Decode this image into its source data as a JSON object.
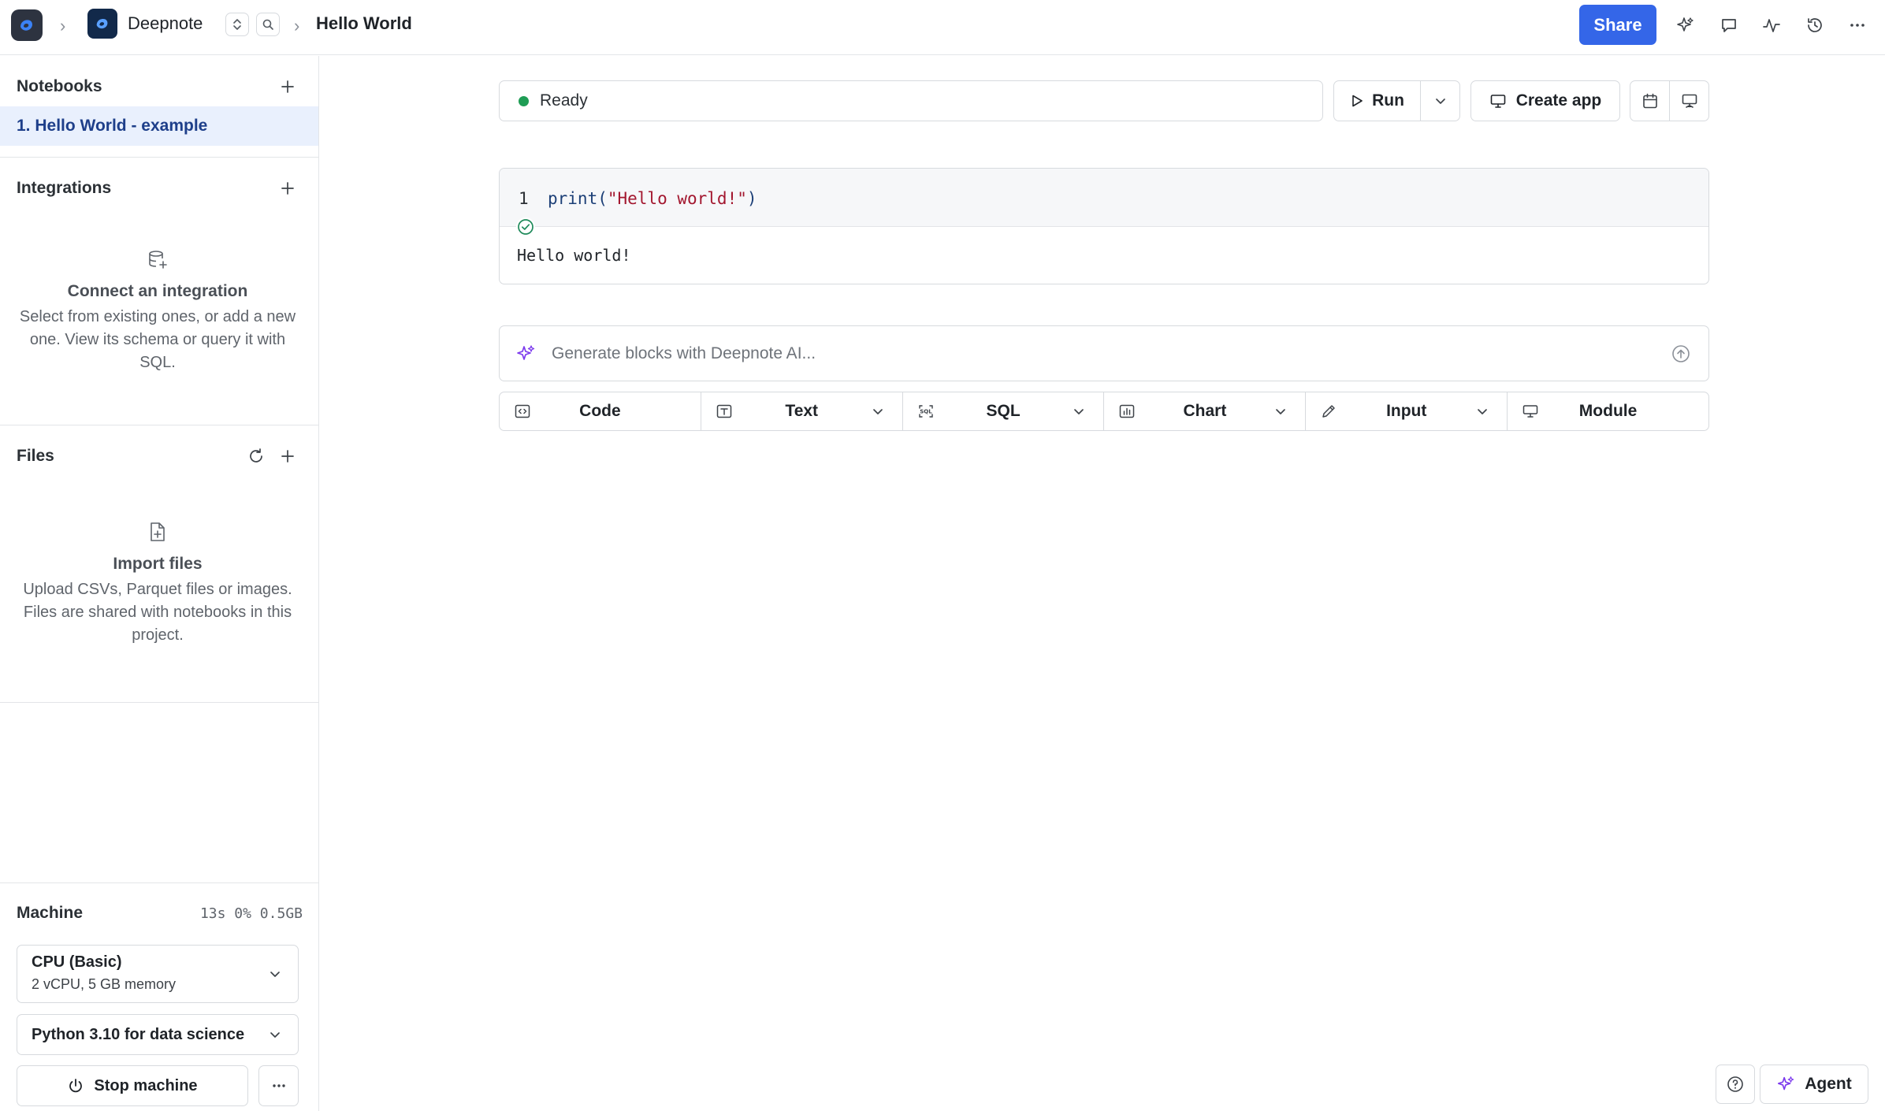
{
  "topbar": {
    "workspace_name": "Deepnote",
    "page_name": "Hello World",
    "share_label": "Share"
  },
  "sidebar": {
    "notebooks_title": "Notebooks",
    "notebook_items": [
      {
        "label": "1. Hello World - example",
        "active": true
      }
    ],
    "integrations_title": "Integrations",
    "integrations_empty": {
      "title": "Connect an integration",
      "description": "Select from existing ones, or add a new one. View its schema or query it with SQL."
    },
    "files_title": "Files",
    "files_empty": {
      "title": "Import files",
      "description": "Upload CSVs, Parquet files or images. Files are shared with notebooks in this project."
    },
    "machine": {
      "title": "Machine",
      "stats": "13s 0% 0.5GB",
      "cpu_name": "CPU (Basic)",
      "cpu_spec": "2 vCPU, 5 GB memory",
      "environment": "Python 3.10 for data science",
      "stop_label": "Stop machine"
    }
  },
  "toolbar": {
    "status": "Ready",
    "status_color": "#1f9d55",
    "run_label": "Run",
    "create_app_label": "Create app"
  },
  "code_block": {
    "line_number": "1",
    "code_prefix": "print(",
    "code_string": "\"Hello world!\"",
    "code_suffix": ")",
    "output": "Hello world!"
  },
  "ai_bar": {
    "placeholder": "Generate blocks with Deepnote AI..."
  },
  "block_types": {
    "code": "Code",
    "text": "Text",
    "sql": "SQL",
    "chart": "Chart",
    "input": "Input",
    "module": "Module"
  },
  "bottom": {
    "agent_label": "Agent"
  },
  "colors": {
    "accent": "#3466e8",
    "active_nav_bg": "#e9f0fd",
    "ai_purple": "#7c3aed"
  }
}
